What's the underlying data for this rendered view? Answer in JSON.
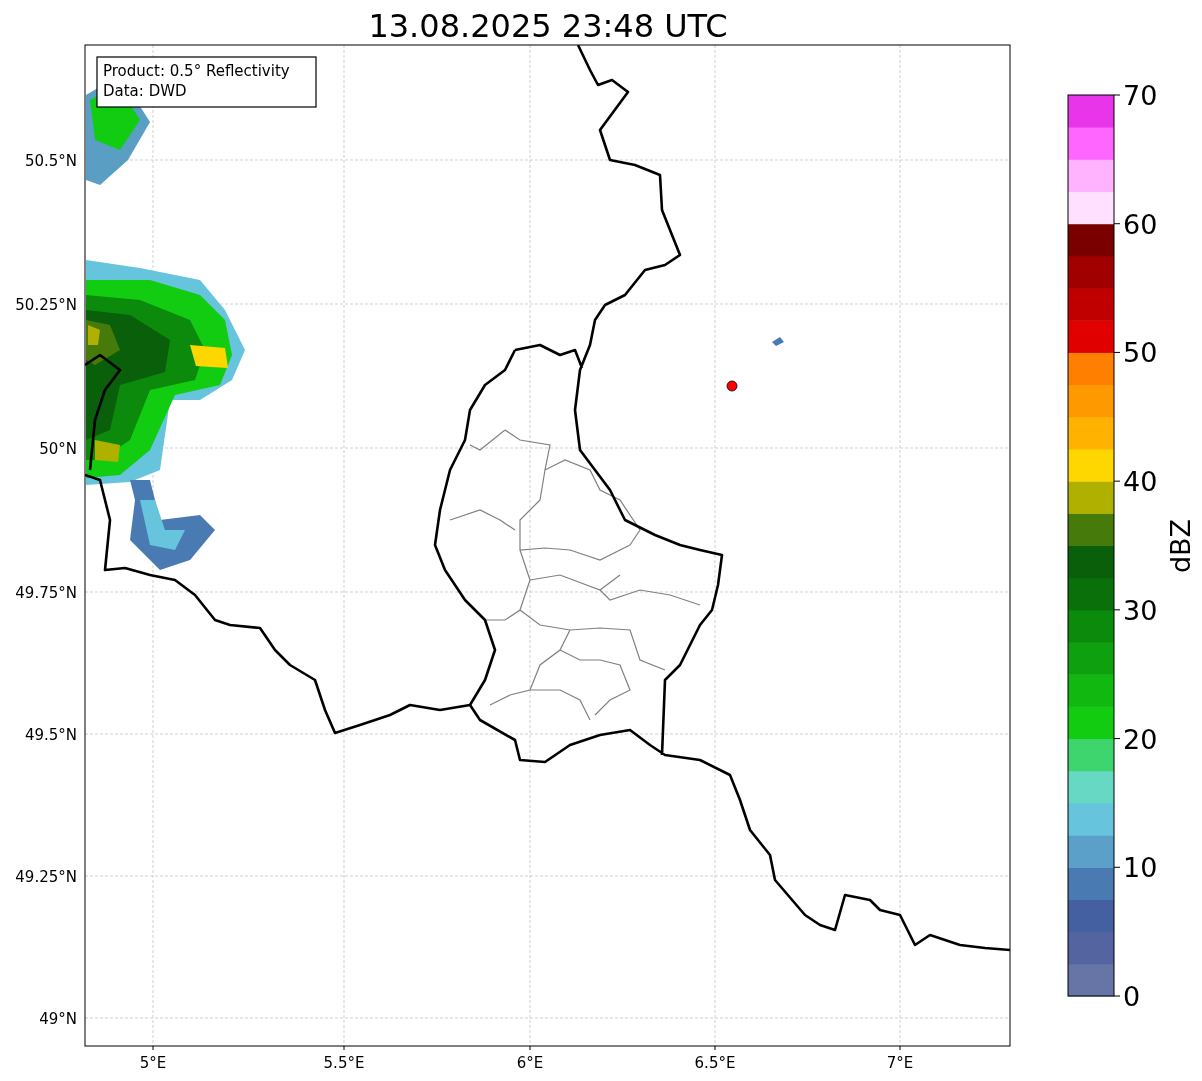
{
  "title": "13.08.2025 23:48 UTC",
  "info_box": [
    "Product: 0.5° Reflectivity",
    "Data: DWD"
  ],
  "map": {
    "x_ticks": [
      "5°E",
      "5.5°E",
      "6°E",
      "6.5°E",
      "7°E"
    ],
    "y_ticks": [
      "50.5°N",
      "50.25°N",
      "50°N",
      "49.75°N",
      "49.5°N",
      "49.25°N",
      "49°N"
    ]
  },
  "colorbar": {
    "label": "dBZ",
    "ticks": [
      "70",
      "60",
      "50",
      "40",
      "30",
      "20",
      "10",
      "0"
    ],
    "segments": [
      {
        "color": "#6674a6"
      },
      {
        "color": "#5464a0"
      },
      {
        "color": "#4460a0"
      },
      {
        "color": "#4a7ab2"
      },
      {
        "color": "#5aa0c8"
      },
      {
        "color": "#66c4dc"
      },
      {
        "color": "#66d8c4"
      },
      {
        "color": "#3ed46e"
      },
      {
        "color": "#12cc12"
      },
      {
        "color": "#10b810"
      },
      {
        "color": "#0ea00e"
      },
      {
        "color": "#0c8a0c"
      },
      {
        "color": "#0a700a"
      },
      {
        "color": "#0a5f0a"
      },
      {
        "color": "#467a0a"
      },
      {
        "color": "#b0b000"
      },
      {
        "color": "#ffd700"
      },
      {
        "color": "#ffb300"
      },
      {
        "color": "#ff9900"
      },
      {
        "color": "#ff7f00"
      },
      {
        "color": "#e00000"
      },
      {
        "color": "#c00000"
      },
      {
        "color": "#a00000"
      },
      {
        "color": "#7a0000"
      },
      {
        "color": "#ffe0ff"
      },
      {
        "color": "#ffb3ff"
      },
      {
        "color": "#ff66ff"
      },
      {
        "color": "#e935e9"
      }
    ]
  }
}
